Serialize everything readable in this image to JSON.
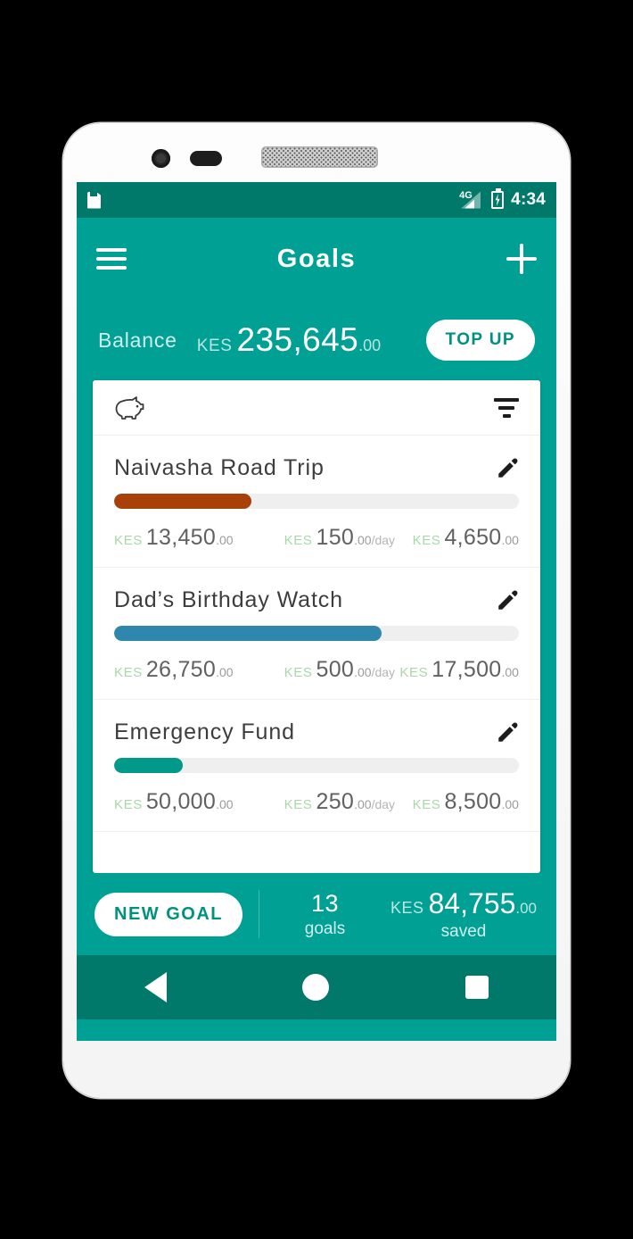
{
  "statusbar": {
    "sd_icon": "sd-card-icon",
    "network": "4G",
    "signal_icon": "signal-bars-icon",
    "battery_icon": "battery-charging-icon",
    "time": "4:34"
  },
  "appbar": {
    "menu_icon": "hamburger-menu-icon",
    "title": "Goals",
    "add_icon": "plus-icon"
  },
  "balance": {
    "label": "Balance",
    "currency": "KES",
    "amount": "235,645",
    "cents": ".00",
    "topup_label": "TOP UP"
  },
  "card": {
    "piggy_icon": "piggy-bank-icon",
    "filter_icon": "filter-icon"
  },
  "goals": [
    {
      "title": "Naivasha Road Trip",
      "edit_icon": "pencil-edit-icon",
      "progress": 34,
      "color": "#a8400a",
      "target": {
        "currency": "KES",
        "amount": "13,450",
        "cents": ".00"
      },
      "rate": {
        "currency": "KES",
        "amount": "150",
        "cents": ".00",
        "per": "/day"
      },
      "saved": {
        "currency": "KES",
        "amount": "4,650",
        "cents": ".00"
      }
    },
    {
      "title": "Dad’s Birthday Watch",
      "edit_icon": "pencil-edit-icon",
      "progress": 66,
      "color": "#3087ad",
      "target": {
        "currency": "KES",
        "amount": "26,750",
        "cents": ".00"
      },
      "rate": {
        "currency": "KES",
        "amount": "500",
        "cents": ".00",
        "per": "/day"
      },
      "saved": {
        "currency": "KES",
        "amount": "17,500",
        "cents": ".00"
      }
    },
    {
      "title": "Emergency Fund",
      "edit_icon": "pencil-edit-icon",
      "progress": 17,
      "color": "#00998a",
      "target": {
        "currency": "KES",
        "amount": "50,000",
        "cents": ".00"
      },
      "rate": {
        "currency": "KES",
        "amount": "250",
        "cents": ".00",
        "per": "/day"
      },
      "saved": {
        "currency": "KES",
        "amount": "8,500",
        "cents": ".00"
      }
    }
  ],
  "summary": {
    "new_goal_label": "NEW GOAL",
    "count": "13",
    "count_label": "goals",
    "saved_currency": "KES",
    "saved_amount": "84,755",
    "saved_cents": ".00",
    "saved_label": "saved"
  },
  "navbar": {
    "back_icon": "android-back-icon",
    "home_icon": "android-home-icon",
    "recents_icon": "android-recents-icon"
  },
  "theme": {
    "statusbar_teal": "#00796b",
    "appbar_teal": "#00a094",
    "accent_white": "#ffffff",
    "kes_green": "#a8d8a8"
  }
}
